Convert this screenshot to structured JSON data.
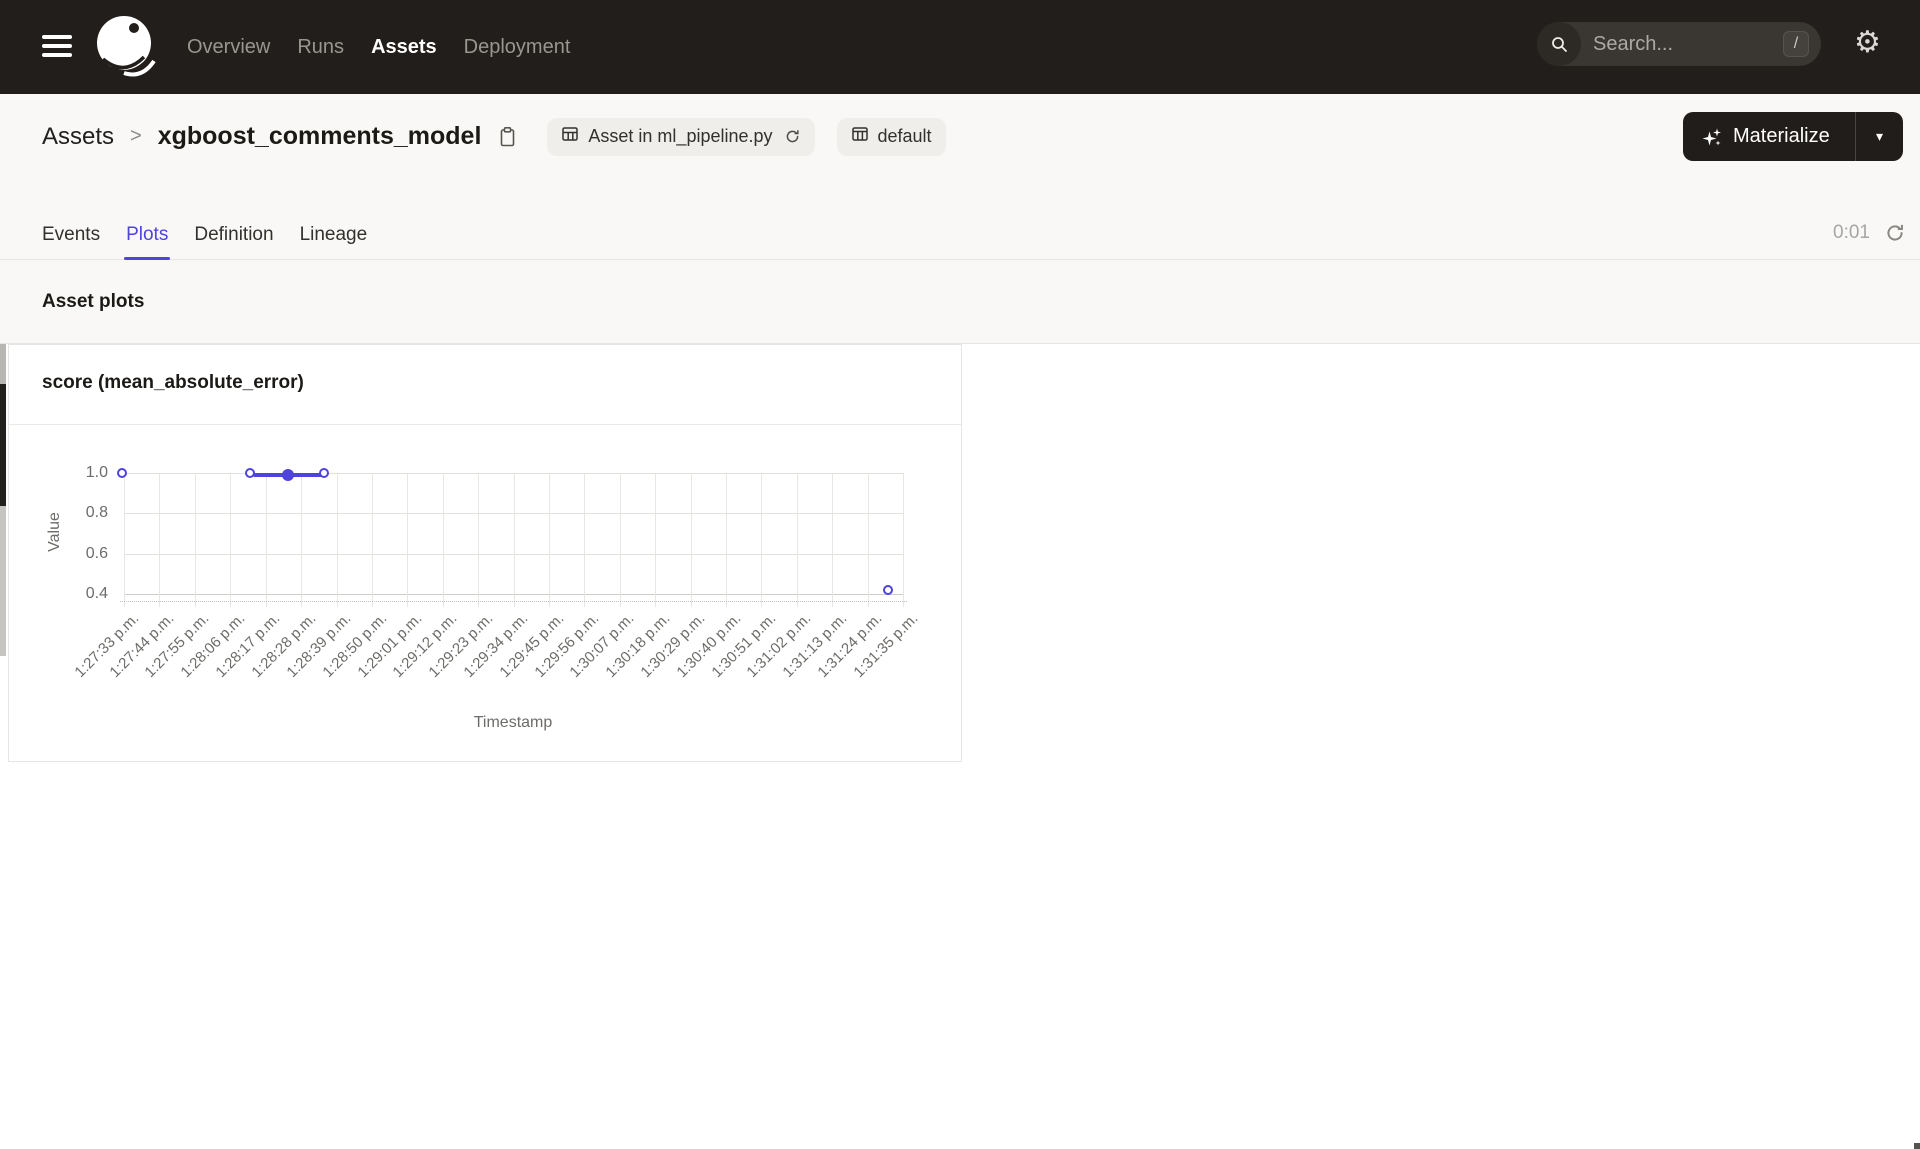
{
  "nav": {
    "items": [
      {
        "label": "Overview",
        "active": false
      },
      {
        "label": "Runs",
        "active": false
      },
      {
        "label": "Assets",
        "active": true
      },
      {
        "label": "Deployment",
        "active": false
      }
    ],
    "search_placeholder": "Search...",
    "search_shortcut": "/"
  },
  "header": {
    "breadcrumb_root": "Assets",
    "breadcrumb_separator": ">",
    "title": "xgboost_comments_model",
    "tags": [
      {
        "label": "Asset in ml_pipeline.py",
        "icon": "asset-grid-icon",
        "refresh": true
      },
      {
        "label": "default",
        "icon": "repo-icon",
        "refresh": false
      }
    ],
    "materialize_label": "Materialize"
  },
  "tabs": {
    "items": [
      {
        "label": "Events",
        "active": false
      },
      {
        "label": "Plots",
        "active": true
      },
      {
        "label": "Definition",
        "active": false
      },
      {
        "label": "Lineage",
        "active": false
      }
    ],
    "refresh_timer": "0:01"
  },
  "section": {
    "title": "Asset plots"
  },
  "chart_data": {
    "type": "line",
    "title": "score (mean_absolute_error)",
    "xlabel": "Timestamp",
    "ylabel": "Value",
    "ylim": [
      0.4,
      1.0
    ],
    "yticks": [
      "1.0",
      "0.8",
      "0.6",
      "0.4"
    ],
    "ytick_values": [
      1.0,
      0.8,
      0.6,
      0.4
    ],
    "grid": true,
    "legend_position": "none",
    "x_span_seconds": 242,
    "x_tick_interval_seconds": 11,
    "xticklabels": [
      "1:27:33 p.m.",
      "1:27:44 p.m.",
      "1:27:55 p.m.",
      "1:28:06 p.m.",
      "1:28:17 p.m.",
      "1:28:28 p.m.",
      "1:28:39 p.m.",
      "1:28:50 p.m.",
      "1:29:01 p.m.",
      "1:29:12 p.m.",
      "1:29:23 p.m.",
      "1:29:34 p.m.",
      "1:29:45 p.m.",
      "1:29:56 p.m.",
      "1:30:07 p.m.",
      "1:30:18 p.m.",
      "1:30:29 p.m.",
      "1:30:40 p.m.",
      "1:30:51 p.m.",
      "1:31:02 p.m.",
      "1:31:13 p.m.",
      "1:31:24 p.m.",
      "1:31:35 p.m."
    ],
    "series": [
      {
        "name": "score (mean_absolute_error)",
        "color": "#4F43DD",
        "points": [
          {
            "time": "1:27:33 p.m.",
            "seconds": 0,
            "value": 0.99,
            "marker": "open"
          },
          {
            "time": "1:28:13 p.m.",
            "seconds": 40,
            "value": 0.99,
            "marker": "open"
          },
          {
            "time": "1:28:24 p.m.",
            "seconds": 51,
            "value": 0.99,
            "marker": "filled"
          },
          {
            "time": "1:28:36 p.m.",
            "seconds": 63,
            "value": 0.99,
            "marker": "open"
          },
          {
            "time": "1:31:31 p.m.",
            "seconds": 238,
            "value": 0.41,
            "marker": "open"
          }
        ],
        "connected_point_indices": [
          1,
          2,
          3
        ]
      }
    ]
  },
  "colors": {
    "accent": "#4F43DD",
    "chart_line": "#4F43DD",
    "nav_bg": "#211E1C",
    "nav_text_muted": "#99968F",
    "page_bg": "#FFFFFF",
    "header_band_bg": "#F9F8F6",
    "border": "#E7E5E2",
    "tag_bg": "#F0EEEB",
    "text_dark": "#1C1A17",
    "text_gray": "#6E6C69",
    "materialize_bg": "#211D1A",
    "timer_text": "#A8A6A3"
  }
}
